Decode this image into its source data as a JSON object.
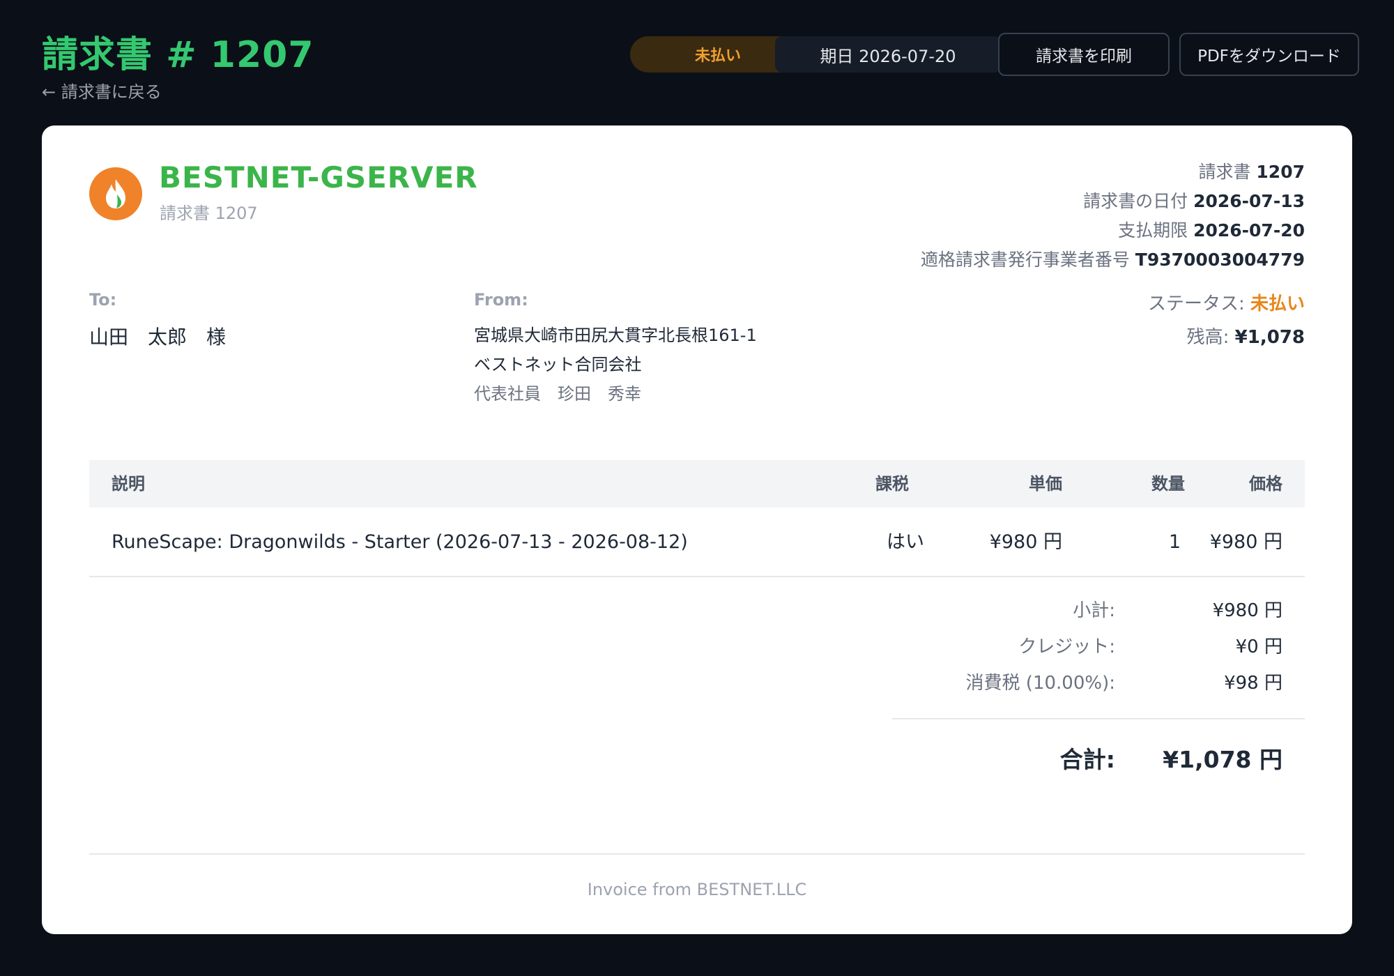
{
  "header": {
    "title": "請求書 # 1207",
    "back_link": "← 請求書に戻る",
    "status_pill": "未払い",
    "due_pill": "期日 2026-07-20",
    "print_button": "請求書を印刷",
    "pdf_button": "PDFをダウンロード"
  },
  "company": {
    "logo_icon": "flame-icon",
    "name": "BESTNET-GSERVER",
    "subtitle": "請求書 1207"
  },
  "meta": {
    "invoice_label": "請求書",
    "invoice_value": "1207",
    "date_label": "請求書の日付",
    "date_value": "2026-07-13",
    "due_label": "支払期限",
    "due_value": "2026-07-20",
    "reg_label": "適格請求書発行事業者番号",
    "reg_value": "T9370003004779"
  },
  "to": {
    "label": "To:",
    "name": "山田　太郎　様"
  },
  "from": {
    "label": "From:",
    "address": "宮城県大崎市田尻大貫字北長根161-1",
    "company": "ベストネット合同会社",
    "representative": "代表社員　珍田　秀幸"
  },
  "status": {
    "label": "ステータス:",
    "value": "未払い",
    "balance_label": "残高:",
    "balance_value": "¥1,078"
  },
  "table": {
    "headers": {
      "description": "説明",
      "taxed": "課税",
      "unit_price": "単価",
      "quantity": "数量",
      "price": "価格"
    },
    "rows": [
      {
        "description": "RuneScape: Dragonwilds - Starter (2026-07-13 - 2026-08-12)",
        "taxed": "はい",
        "unit_price": "¥980 円",
        "quantity": "1",
        "price": "¥980 円"
      }
    ]
  },
  "totals": {
    "subtotal_label": "小計:",
    "subtotal_value": "¥980 円",
    "credit_label": "クレジット:",
    "credit_value": "¥0 円",
    "tax_label": "消費税 (10.00%):",
    "tax_value": "¥98 円",
    "total_label": "合計:",
    "total_value": "¥1,078 円"
  },
  "footer": "Invoice from BESTNET.LLC",
  "colors": {
    "title_green": "#34c870",
    "brand_green": "#3bb54a",
    "logo_orange": "#f0822a",
    "unpaid_orange": "#e8861a",
    "background": "#0b0f17"
  }
}
